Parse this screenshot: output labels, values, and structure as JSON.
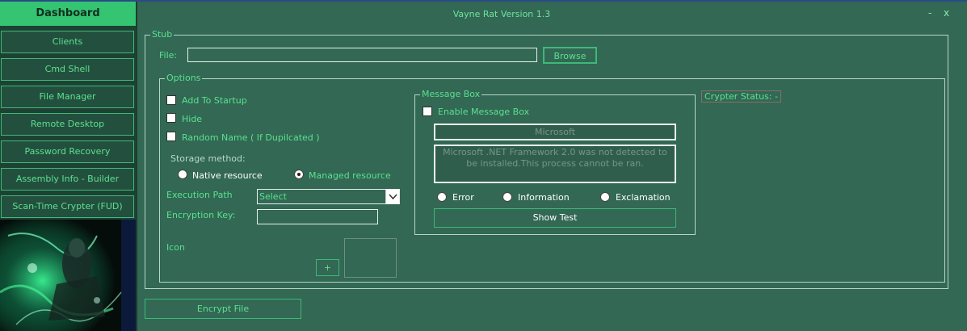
{
  "window": {
    "title": "Vayne Rat Version 1.3",
    "minimize": "-",
    "close": "x"
  },
  "sidebar": {
    "dashboard": "Dashboard",
    "items": [
      "Clients",
      "Cmd Shell",
      "File Manager",
      "Remote Desktop",
      "Password Recovery",
      "Assembly Info - Builder",
      "Scan-Time Crypter (FUD)"
    ]
  },
  "stub": {
    "legend": "Stub",
    "file_label": "File:",
    "file_value": "",
    "browse": "Browse"
  },
  "options": {
    "legend": "Options",
    "add_to_startup": "Add To Startup",
    "hide": "Hide",
    "random_name": "Random Name ( If Dupilcated )",
    "storage_method": "Storage method:",
    "native_resource": "Native resource",
    "managed_resource": "Managed resource",
    "storage_selected": "Managed resource",
    "execution_path_label": "Execution Path",
    "execution_path_value": "Select",
    "encryption_key_label": "Encryption Key:",
    "encryption_key_value": "",
    "icon_label": "Icon",
    "icon_add": "+"
  },
  "message_box": {
    "legend": "Message Box",
    "enable": "Enable Message Box",
    "title_value": "Microsoft",
    "body_value": "Microsoft .NET Framework 2.0 was not detected to be installed.This process cannot be ran.",
    "error": "Error",
    "information": "Information",
    "exclamation": "Exclamation",
    "show_test": "Show Test"
  },
  "crypter_status": "Crypter Status: -",
  "encrypt_file": "Encrypt File",
  "colors": {
    "accent": "#34c472",
    "background": "#326854",
    "text": "#5ce08f"
  }
}
